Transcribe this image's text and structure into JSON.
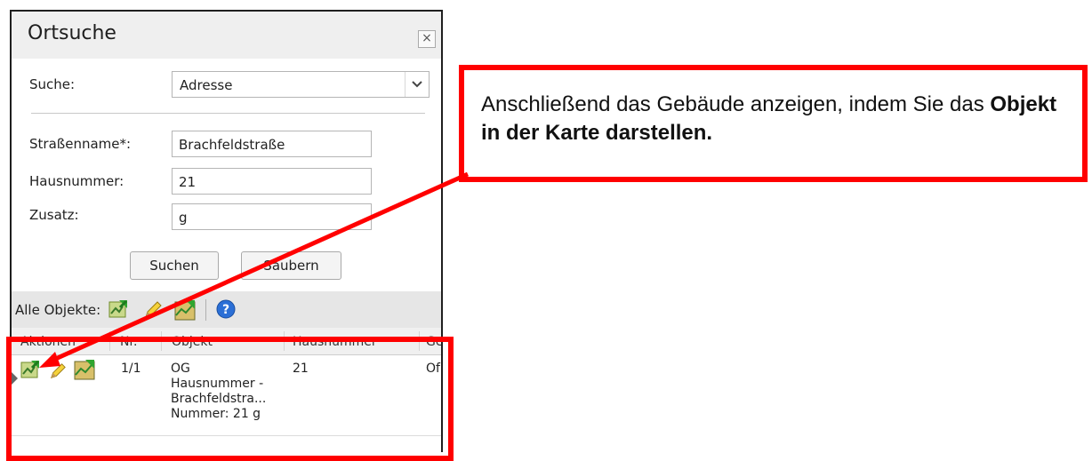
{
  "panel": {
    "title": "Ortsuche",
    "close_glyph": "×",
    "search_label": "Suche:",
    "search_type": "Adresse",
    "fields": [
      {
        "label": "Straßenname*:",
        "value": "Brachfeldstraße"
      },
      {
        "label": "Hausnummer:",
        "value": "21"
      },
      {
        "label": "Zusatz:",
        "value": "g"
      }
    ],
    "buttons": {
      "search": "Suchen",
      "clear": "Säubern"
    },
    "toolbar_label": "Alle Objekte:",
    "columns": [
      "Aktionen",
      "Nr.",
      "Objekt",
      "Hausnummer",
      "Ge"
    ],
    "row": {
      "nr": "1/1",
      "objekt_lines": [
        "OG",
        "Hausnummer -",
        "Brachfeldstra...",
        "Nummer: 21 g"
      ],
      "hausnummer": "21",
      "ge": "Of"
    }
  },
  "callout": {
    "text_plain": "Anschließend das Gebäude anzeigen, indem Sie das ",
    "text_bold": "Objekt in der Karte darstellen."
  },
  "icons": [
    "map-zoom-icon",
    "pencil-edit-icon",
    "map-display-icon",
    "help-icon",
    "chevron-down-icon",
    "close-icon"
  ],
  "colors": {
    "annotation_red": "#ff0000",
    "header_bg": "#efefef",
    "toolbar_bg": "#e6e6e6",
    "help_blue": "#2b6fd6"
  }
}
